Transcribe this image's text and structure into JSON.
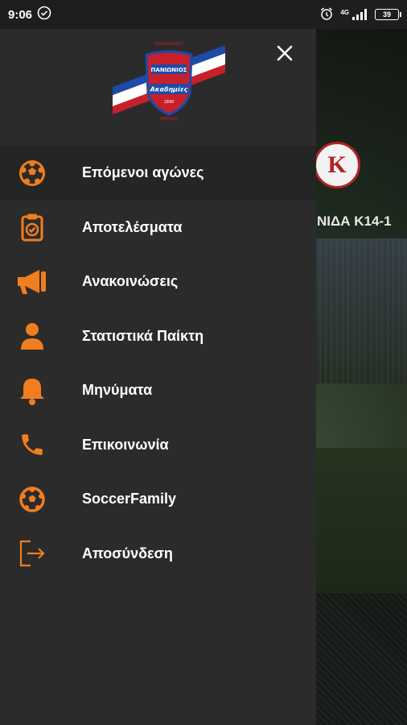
{
  "status_bar": {
    "time": "9:06",
    "network": "4G",
    "battery": "39"
  },
  "background": {
    "team_logo_letter": "K",
    "team_name": "ΝΙΔΑ Κ14-1"
  },
  "drawer": {
    "logo": {
      "top_text": "ΠΟΔΟΣΦΑΙΡΟ",
      "name": "ΠΑΝΙΩΝΙΟΣ",
      "subtitle": "Ακαδημίες",
      "year": "1890",
      "bottom_text": "ΝΕΟΛΑΙΑ"
    },
    "menu": [
      {
        "label": "Επόμενοι αγώνες",
        "icon": "soccer-ball-icon"
      },
      {
        "label": "Αποτελέσματα",
        "icon": "clipboard-check-icon"
      },
      {
        "label": "Ανακοινώσεις",
        "icon": "megaphone-icon"
      },
      {
        "label": "Στατιστικά Παίκτη",
        "icon": "user-icon"
      },
      {
        "label": "Μηνύματα",
        "icon": "bell-icon"
      },
      {
        "label": "Επικοινωνία",
        "icon": "phone-icon"
      },
      {
        "label": "SoccerFamily",
        "icon": "soccer-ball-outline-icon"
      },
      {
        "label": "Αποσύνδεση",
        "icon": "logout-icon"
      }
    ]
  },
  "colors": {
    "accent": "#F07E1E",
    "drawer_bg": "#2B2B2B",
    "active_item_bg": "#252525"
  }
}
